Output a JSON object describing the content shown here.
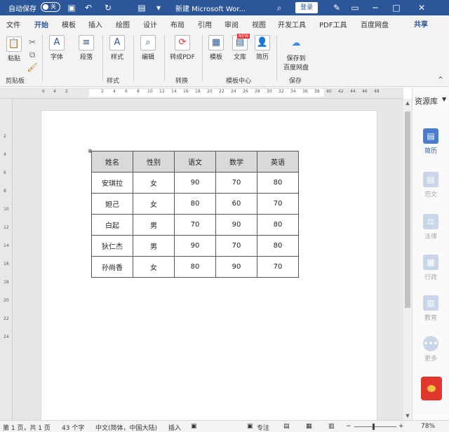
{
  "titlebar": {
    "autosave_label": "自动保存",
    "autosave_state": "关",
    "doc_title": "新建 Microsoft Wor...",
    "login_label": "登录"
  },
  "tabs": [
    "文件",
    "开始",
    "模板",
    "插入",
    "绘图",
    "设计",
    "布局",
    "引用",
    "审阅",
    "视图",
    "开发工具",
    "PDF工具",
    "百度网盘"
  ],
  "active_tab": "开始",
  "share_label": "共享",
  "ribbon": {
    "paste": "粘贴",
    "font": "字体",
    "paragraph": "段落",
    "styles": "样式",
    "edit": "编辑",
    "to_pdf": "转成PDF",
    "template": "模板",
    "wenku": "文库",
    "resume": "简历",
    "save_to": "保存到",
    "baidu_disk": "百度网盘",
    "new_badge": "NEW",
    "groups": {
      "clipboard": "剪贴板",
      "styles": "样式",
      "convert": "转换",
      "template_center": "模板中心",
      "save": "保存"
    }
  },
  "ruler": {
    "ticks": [
      "6",
      "4",
      "2",
      "2",
      "4",
      "6",
      "8",
      "10",
      "12",
      "14",
      "16",
      "18",
      "20",
      "22",
      "24",
      "26",
      "28",
      "30",
      "32",
      "34",
      "36",
      "38",
      "40",
      "42",
      "44",
      "46",
      "48"
    ]
  },
  "vruler": {
    "ticks": [
      "2",
      "4",
      "6",
      "8",
      "10",
      "12",
      "14",
      "16",
      "18",
      "20",
      "22",
      "24"
    ]
  },
  "table": {
    "headers": [
      "姓名",
      "性别",
      "语文",
      "数学",
      "英语"
    ],
    "rows": [
      [
        "安琪拉",
        "女",
        "90",
        "70",
        "80"
      ],
      [
        "妲己",
        "女",
        "80",
        "60",
        "70"
      ],
      [
        "白起",
        "男",
        "70",
        "90",
        "80"
      ],
      [
        "狄仁杰",
        "男",
        "90",
        "70",
        "80"
      ],
      [
        "孙尚香",
        "女",
        "80",
        "90",
        "70"
      ]
    ]
  },
  "resource_panel": {
    "title": "资源库",
    "items": [
      {
        "label": "简历",
        "icon": "resume-icon"
      },
      {
        "label": "范文",
        "icon": "essay-icon"
      },
      {
        "label": "法律",
        "icon": "law-icon"
      },
      {
        "label": "行政",
        "icon": "admin-icon"
      },
      {
        "label": "教育",
        "icon": "education-icon"
      },
      {
        "label": "更多",
        "icon": "more-icon"
      }
    ]
  },
  "statusbar": {
    "page": "第 1 页，共 1 页",
    "words": "43 个字",
    "language": "中文(简体，中国大陆)",
    "insert_mode": "插入",
    "focus": "专注",
    "zoom": "78%"
  }
}
